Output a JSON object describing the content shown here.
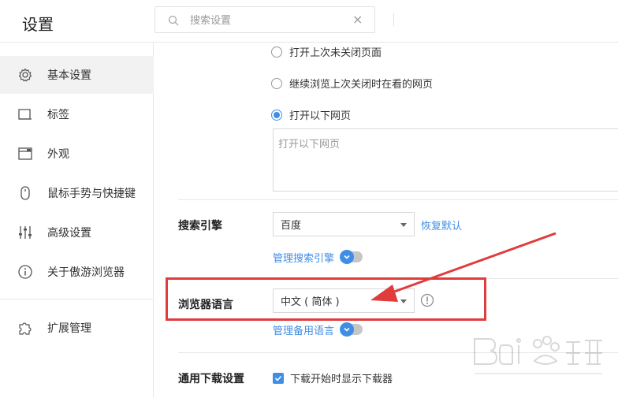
{
  "header": {
    "title": "设置",
    "search_placeholder": "搜索设置",
    "clear_label": "×"
  },
  "sidebar": {
    "items": [
      {
        "label": "基本设置",
        "icon": "gear-icon",
        "active": true
      },
      {
        "label": "标签",
        "icon": "tab-icon"
      },
      {
        "label": "外观",
        "icon": "window-icon"
      },
      {
        "label": "鼠标手势与快捷键",
        "icon": "mouse-icon"
      },
      {
        "label": "高级设置",
        "icon": "sliders-icon"
      },
      {
        "label": "关于傲游浏览器",
        "icon": "info-icon"
      },
      {
        "label": "扩展管理",
        "icon": "puzzle-icon"
      }
    ]
  },
  "startup": {
    "options": [
      {
        "label": "打开上次未关闭页面",
        "checked": false
      },
      {
        "label": "继续浏览上次关闭时在看的网页",
        "checked": false
      },
      {
        "label": "打开以下网页",
        "checked": true
      }
    ],
    "pages_placeholder": "打开以下网页"
  },
  "search_engine": {
    "label": "搜索引擎",
    "selected": "百度",
    "restore_label": "恢复默认",
    "manage_label": "管理搜索引擎"
  },
  "language": {
    "label": "浏览器语言",
    "selected": "中文 ( 简体 )",
    "manage_label": "管理备用语言"
  },
  "download": {
    "label": "通用下载设置",
    "show_downloader_label": "下载开始时显示下载器",
    "show_downloader_checked": true
  },
  "colors": {
    "accent": "#3f8ee6",
    "annotation": "#e03c3c"
  }
}
